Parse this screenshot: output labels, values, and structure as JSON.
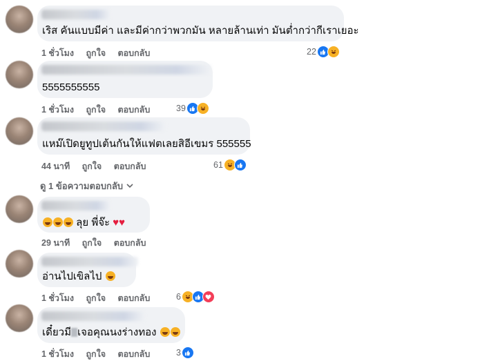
{
  "actions": {
    "like": "ถูกใจ",
    "reply": "ตอบกลับ"
  },
  "comments": [
    {
      "text": "เริส คันแบบมีค่า และมีค่ากว่าพวกมัน หลายล้านเท่า มันต่ำกว่ากีเราเยอะ",
      "time": "1 ชั่วโมง",
      "reactions": "22"
    },
    {
      "text": "5555555555",
      "time": "1 ชั่วโมง",
      "reactions": "39"
    },
    {
      "text": "แหม๊เปิดยูทูปเต้นกันให้แฟตเลยสิอีเขมร 555555",
      "time": "44 นาที",
      "reactions": "61"
    },
    {
      "text": "ลุย พี่จ๊ะ",
      "time": "29 นาที",
      "reactions": ""
    },
    {
      "text": "อ่านไปเขิลไป",
      "time": "1 ชั่วโมง",
      "reactions": "6"
    },
    {
      "text_a": "เดี๋ยวมี",
      "text_b": "เจอคุณนงร่างทอง",
      "time": "1 ชั่วโมง",
      "reactions": "3"
    }
  ],
  "view_replies": "ดู 1 ข้อความตอบกลับ",
  "colors": {
    "like": "#1877f2",
    "haha": "#f7b125",
    "love": "#f33e58",
    "bubble": "#f0f2f5",
    "meta": "#65676b"
  }
}
